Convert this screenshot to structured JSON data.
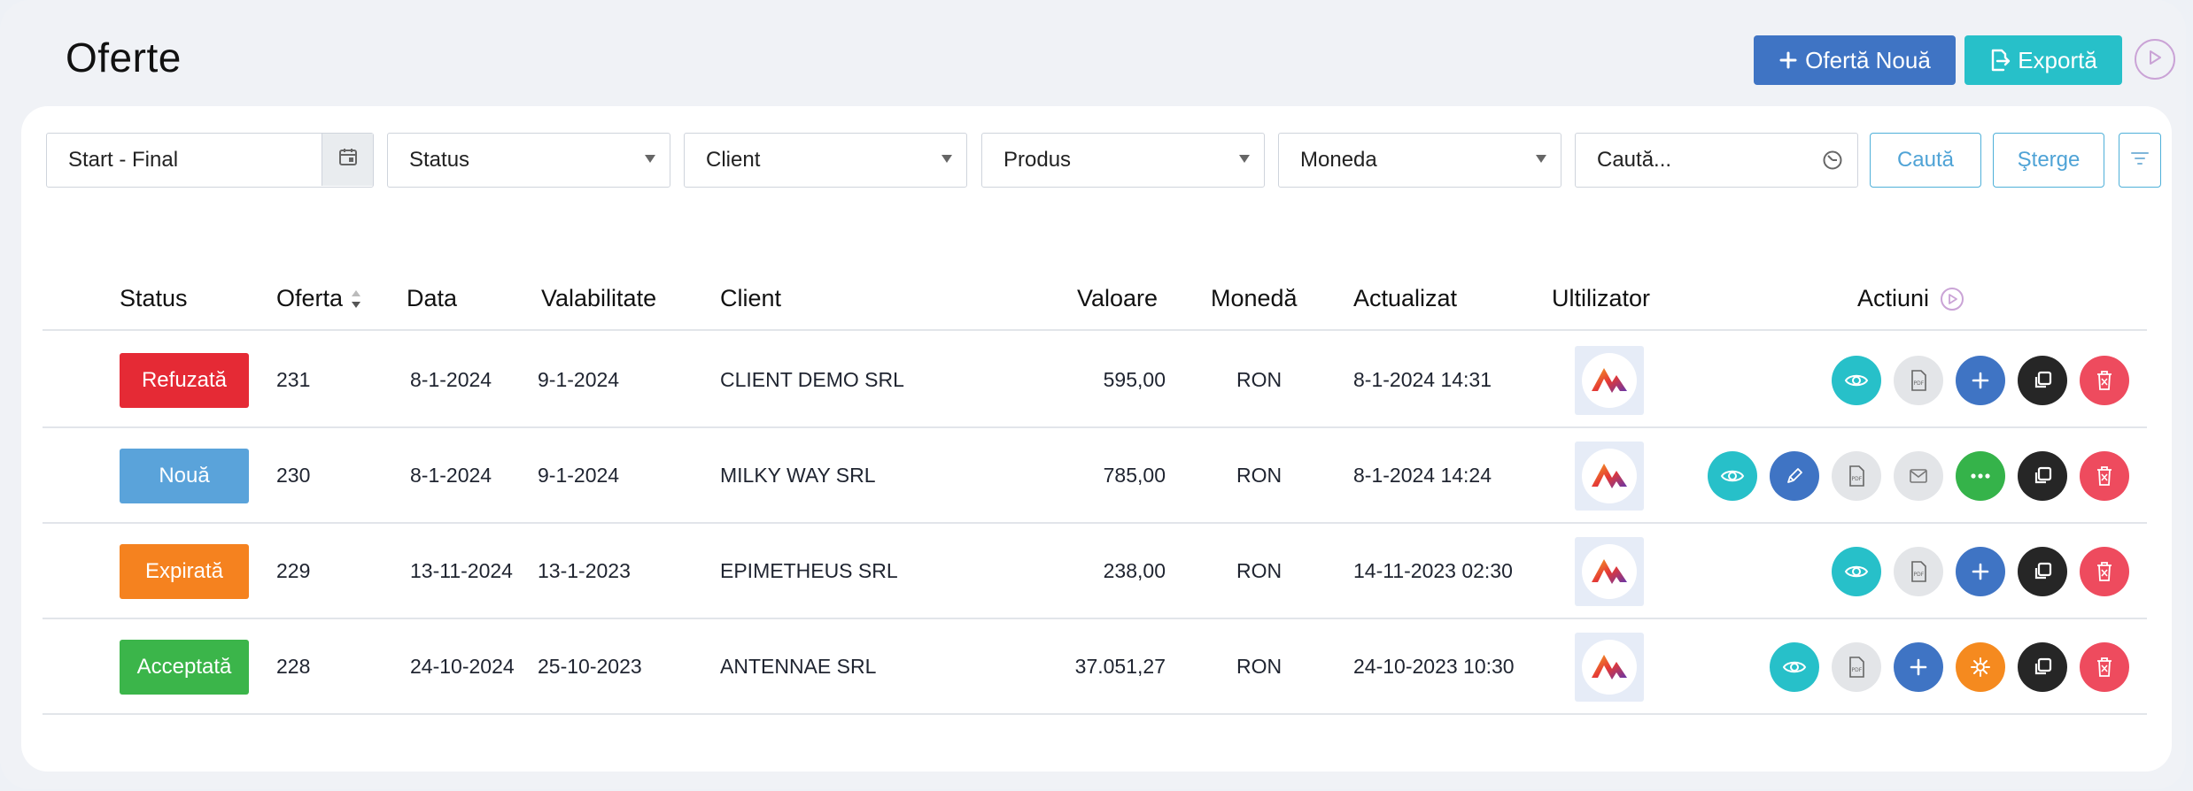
{
  "page": {
    "title": "Oferte"
  },
  "toolbar": {
    "new_label": "Ofertă Nouă",
    "export_label": "Exportă"
  },
  "filters": {
    "date_range": "Start - Final",
    "status": "Status",
    "client": "Client",
    "product": "Produs",
    "currency": "Moneda",
    "search_placeholder": "Caută...",
    "search_button": "Caută",
    "clear_button": "Şterge"
  },
  "table": {
    "columns": [
      "Status",
      "Oferta",
      "Data",
      "Valabilitate",
      "Client",
      "Valoare",
      "Monedă",
      "Actualizat",
      "Ultilizator",
      "Actiuni"
    ],
    "rows": [
      {
        "status": "Refuzată",
        "status_color": "#e52a35",
        "offer": "231",
        "date": "8-1-2024",
        "validity": "9-1-2024",
        "client": "CLIENT DEMO SRL",
        "value": "595,00",
        "currency": "RON",
        "updated": "8-1-2024 14:31",
        "actions": [
          "view-icon",
          "pdf-icon",
          "add-icon",
          "copy-icon",
          "delete-icon"
        ]
      },
      {
        "status": "Nouă",
        "status_color": "#5aa3da",
        "offer": "230",
        "date": "8-1-2024",
        "validity": "9-1-2024",
        "client": "MILKY WAY SRL",
        "value": "785,00",
        "currency": "RON",
        "updated": "8-1-2024 14:24",
        "actions": [
          "view-icon",
          "edit-icon",
          "pdf-icon",
          "email-icon",
          "more-icon",
          "copy-icon",
          "delete-icon"
        ]
      },
      {
        "status": "Expirată",
        "status_color": "#f5821f",
        "offer": "229",
        "date": "13-11-2024",
        "validity": "13-1-2023",
        "client": "EPIMETHEUS SRL",
        "value": "238,00",
        "currency": "RON",
        "updated": "14-11-2023 02:30",
        "actions": [
          "view-icon",
          "pdf-icon",
          "add-icon",
          "copy-icon",
          "delete-icon"
        ]
      },
      {
        "status": "Acceptată",
        "status_color": "#3bb54a",
        "offer": "228",
        "date": "24-10-2024",
        "validity": "25-10-2023",
        "client": "ANTENNAE SRL",
        "value": "37.051,27",
        "currency": "RON",
        "updated": "24-10-2023 10:30",
        "actions": [
          "view-icon",
          "pdf-icon",
          "add-icon",
          "settings-icon",
          "copy-icon",
          "delete-icon"
        ]
      }
    ]
  }
}
